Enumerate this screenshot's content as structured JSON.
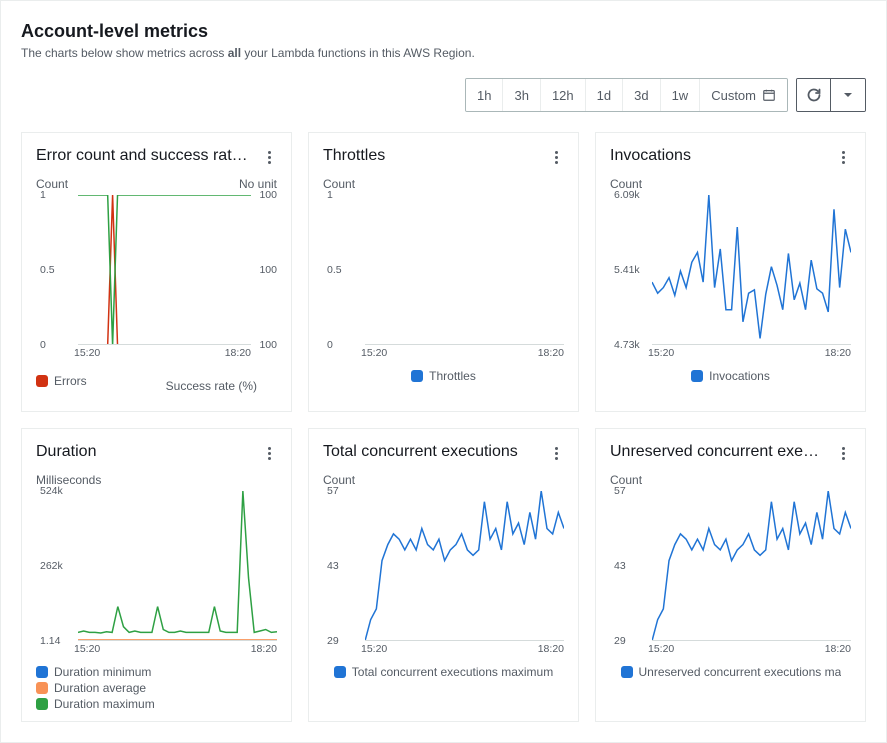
{
  "header": {
    "title": "Account-level metrics",
    "desc_pre": "The charts below show metrics across ",
    "desc_bold": "all",
    "desc_post": " your Lambda functions in this AWS Region."
  },
  "toolbar": {
    "ranges": [
      "1h",
      "3h",
      "12h",
      "1d",
      "3d",
      "1w"
    ],
    "custom_label": "Custom"
  },
  "colors": {
    "blue": "#2074d5",
    "green": "#2ea043",
    "orange": "#f89256",
    "red": "#d13212",
    "grid": "#d5dbdb"
  },
  "chart_data": [
    {
      "id": "errors",
      "title": "Error count and success rat…",
      "axis_left": "Count",
      "axis_right": "No unit",
      "type": "line",
      "xlabels": [
        "15:20",
        "18:20"
      ],
      "yticks_left": [
        "1",
        "0.5",
        "0"
      ],
      "yticks_right": [
        "100",
        "100",
        "100"
      ],
      "series": [
        {
          "name": "Errors",
          "color": "#d13212",
          "values": [
            0,
            0,
            0,
            0,
            0,
            0,
            0,
            1,
            0,
            0,
            0,
            0,
            0,
            0,
            0,
            0,
            0,
            0,
            0,
            0,
            0,
            0,
            0,
            0,
            0,
            0,
            0,
            0,
            0,
            0,
            0,
            0,
            0,
            0,
            0,
            0
          ]
        },
        {
          "name": "Success rate (%)",
          "color": "#2ea043",
          "right_axis": true,
          "values": [
            100,
            100,
            100,
            100,
            100,
            100,
            100,
            0,
            100,
            100,
            100,
            100,
            100,
            100,
            100,
            100,
            100,
            100,
            100,
            100,
            100,
            100,
            100,
            100,
            100,
            100,
            100,
            100,
            100,
            100,
            100,
            100,
            100,
            100,
            100,
            100
          ]
        }
      ],
      "ylim_left": [
        0,
        1
      ],
      "ylim_right": [
        0,
        100
      ]
    },
    {
      "id": "throttles",
      "title": "Throttles",
      "axis_left": "Count",
      "type": "line",
      "xlabels": [
        "15:20",
        "18:20"
      ],
      "yticks_left": [
        "1",
        "0.5",
        "0"
      ],
      "series": [
        {
          "name": "Throttles",
          "color": "#2074d5",
          "values": [
            0,
            0,
            0,
            0,
            0,
            0,
            0,
            0,
            0,
            0,
            0,
            0,
            0,
            0,
            0,
            0,
            0,
            0,
            0,
            0,
            0,
            0,
            0,
            0,
            0,
            0,
            0,
            0,
            0,
            0,
            0,
            0,
            0,
            0,
            0,
            0
          ]
        }
      ],
      "ylim_left": [
        0,
        1
      ]
    },
    {
      "id": "invocations",
      "title": "Invocations",
      "axis_left": "Count",
      "type": "line",
      "xlabels": [
        "15:20",
        "18:20"
      ],
      "yticks_left": [
        "6.09k",
        "5.41k",
        "4.73k"
      ],
      "series": [
        {
          "name": "Invocations",
          "color": "#2074d5",
          "values": [
            5300,
            5200,
            5250,
            5340,
            5180,
            5400,
            5250,
            5480,
            5570,
            5300,
            6090,
            5250,
            5600,
            5050,
            5050,
            5800,
            4940,
            5200,
            5230,
            4790,
            5190,
            5440,
            5270,
            5050,
            5560,
            5140,
            5290,
            5050,
            5500,
            5240,
            5200,
            5030,
            5960,
            5250,
            5780,
            5570
          ]
        }
      ],
      "ylim_left": [
        4730,
        6090
      ]
    },
    {
      "id": "duration",
      "title": "Duration",
      "axis_left": "Milliseconds",
      "type": "line",
      "xlabels": [
        "15:20",
        "18:20"
      ],
      "yticks_left": [
        "524k",
        "262k",
        "1.14"
      ],
      "series": [
        {
          "name": "Duration minimum",
          "color": "#2074d5",
          "values": [
            1,
            1,
            1,
            1,
            1,
            1,
            1,
            1,
            1,
            1,
            1,
            1,
            1,
            1,
            1,
            1,
            1,
            1,
            1,
            1,
            1,
            1,
            1,
            1,
            1,
            1,
            1,
            1,
            1,
            1,
            1,
            1,
            1,
            1,
            1,
            1
          ]
        },
        {
          "name": "Duration average",
          "color": "#f89256",
          "values": [
            4000,
            4000,
            4000,
            4000,
            4000,
            4000,
            4000,
            4000,
            4000,
            4000,
            4000,
            4000,
            4000,
            4000,
            4000,
            4000,
            4000,
            4000,
            4000,
            4000,
            4000,
            4000,
            4000,
            4000,
            4000,
            4000,
            4000,
            4000,
            4000,
            4000,
            4000,
            4000,
            4000,
            4000,
            4000,
            4000
          ]
        },
        {
          "name": "Duration maximum",
          "color": "#2ea043",
          "values": [
            30000,
            35000,
            30000,
            30000,
            28000,
            32000,
            30000,
            120000,
            50000,
            30000,
            35000,
            30000,
            30000,
            30000,
            120000,
            40000,
            30000,
            30000,
            35000,
            30000,
            30000,
            30000,
            30000,
            30000,
            120000,
            35000,
            30000,
            30000,
            30000,
            524000,
            220000,
            30000,
            35000,
            40000,
            30000,
            32000
          ]
        }
      ],
      "ylim_left": [
        1,
        524000
      ]
    },
    {
      "id": "concurrent",
      "title": "Total concurrent executions",
      "axis_left": "Count",
      "type": "line",
      "xlabels": [
        "15:20",
        "18:20"
      ],
      "yticks_left": [
        "57",
        "43",
        "29"
      ],
      "series": [
        {
          "name": "Total concurrent executions maximum",
          "color": "#2074d5",
          "values": [
            29,
            33,
            35,
            44,
            47,
            49,
            48,
            46,
            48,
            46,
            50,
            47,
            46,
            48,
            44,
            46,
            47,
            49,
            46,
            45,
            46,
            55,
            48,
            50,
            46,
            55,
            49,
            51,
            47,
            53,
            48,
            57,
            50,
            49,
            53,
            50
          ]
        }
      ],
      "ylim_left": [
        29,
        57
      ]
    },
    {
      "id": "unreserved",
      "title": "Unreserved concurrent exe…",
      "axis_left": "Count",
      "type": "line",
      "xlabels": [
        "15:20",
        "18:20"
      ],
      "yticks_left": [
        "57",
        "43",
        "29"
      ],
      "series": [
        {
          "name": "Unreserved concurrent executions maximum",
          "color": "#2074d5",
          "values": [
            29,
            33,
            35,
            44,
            47,
            49,
            48,
            46,
            48,
            46,
            50,
            47,
            46,
            48,
            44,
            46,
            47,
            49,
            46,
            45,
            46,
            55,
            48,
            50,
            46,
            55,
            49,
            51,
            47,
            53,
            48,
            57,
            50,
            49,
            53,
            50
          ]
        }
      ],
      "ylim_left": [
        29,
        57
      ]
    }
  ]
}
